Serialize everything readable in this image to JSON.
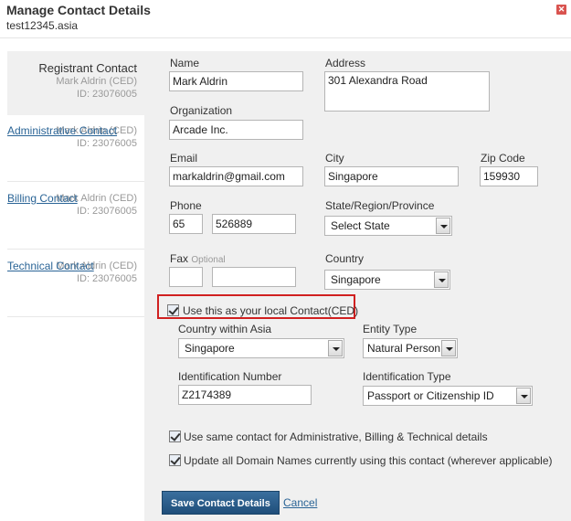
{
  "dialog": {
    "title": "Manage Contact Details",
    "domain": "test12345.asia",
    "close_icon": "close-icon"
  },
  "sidebar": {
    "items": [
      {
        "name": "Registrant Contact",
        "person": "Mark Aldrin (CED)",
        "id": "ID: 23076005",
        "active": true
      },
      {
        "name": "Administrative Contact",
        "person": "Mark Aldrin (CED)",
        "id": "ID: 23076005",
        "active": false
      },
      {
        "name": "Billing Contact",
        "person": "Mark Aldrin (CED)",
        "id": "ID: 23076005",
        "active": false
      },
      {
        "name": "Technical Contact",
        "person": "Mark Aldrin (CED)",
        "id": "ID: 23076005",
        "active": false
      }
    ]
  },
  "form": {
    "name": {
      "label": "Name",
      "value": "Mark Aldrin"
    },
    "address": {
      "label": "Address",
      "value": "301 Alexandra Road"
    },
    "organization": {
      "label": "Organization",
      "value": "Arcade Inc."
    },
    "email": {
      "label": "Email",
      "value": "markaldrin@gmail.com"
    },
    "city": {
      "label": "City",
      "value": "Singapore"
    },
    "zip": {
      "label": "Zip Code",
      "value": "159930"
    },
    "phone": {
      "label": "Phone",
      "code": "65",
      "number": "526889"
    },
    "state": {
      "label": "State/Region/Province",
      "value": "Select State"
    },
    "fax": {
      "label": "Fax",
      "optional": "Optional",
      "code": "",
      "number": ""
    },
    "country": {
      "label": "Country",
      "value": "Singapore"
    },
    "local_contact": {
      "label": "Use this as your local Contact(CED)",
      "checked": true
    },
    "country_asia": {
      "label": "Country within Asia",
      "value": "Singapore"
    },
    "entity_type": {
      "label": "Entity Type",
      "value": "Natural Person"
    },
    "id_number": {
      "label": "Identification Number",
      "value": "Z2174389"
    },
    "id_type": {
      "label": "Identification Type",
      "value": "Passport or Citizenship ID"
    },
    "same_contact": {
      "label": "Use same contact for Administrative, Billing & Technical details",
      "checked": true
    },
    "update_all": {
      "label": "Update all Domain Names currently using this contact (wherever applicable)",
      "checked": true
    }
  },
  "actions": {
    "save": "Save Contact Details",
    "cancel": "Cancel"
  },
  "colors": {
    "accent": "#2a6496",
    "button": "#2b5f8e",
    "highlight": "#d02020",
    "panel": "#f0f0f0"
  }
}
